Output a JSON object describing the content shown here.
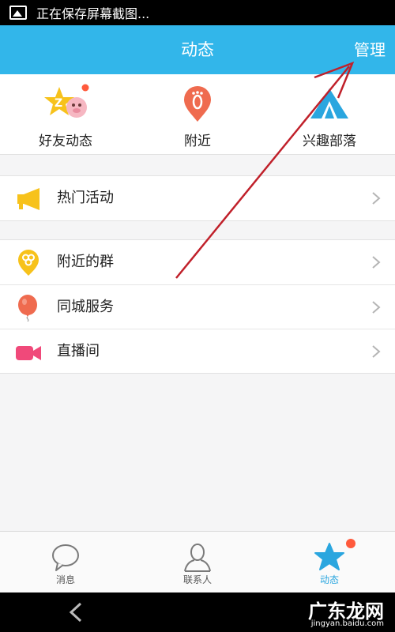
{
  "status_bar": {
    "text": "正在保存屏幕截图..."
  },
  "header": {
    "title": "动态",
    "manage_label": "管理"
  },
  "shortcuts": [
    {
      "label": "好友动态",
      "icon": "friends-feed-star-icon",
      "badge": true
    },
    {
      "label": "附近",
      "icon": "nearby-footprint-icon",
      "badge": false
    },
    {
      "label": "兴趣部落",
      "icon": "interest-tribe-tent-icon",
      "badge": false
    }
  ],
  "groups": [
    [
      {
        "label": "热门活动",
        "icon": "megaphone-icon"
      }
    ],
    [
      {
        "label": "附近的群",
        "icon": "nearby-group-icon"
      },
      {
        "label": "同城服务",
        "icon": "balloon-icon"
      },
      {
        "label": "直播间",
        "icon": "video-camera-icon"
      }
    ]
  ],
  "tabs": [
    {
      "label": "消息",
      "icon": "chat-bubble-icon",
      "active": false
    },
    {
      "label": "联系人",
      "icon": "contacts-person-icon",
      "active": false
    },
    {
      "label": "动态",
      "icon": "star-icon",
      "active": true,
      "badge": true
    }
  ],
  "watermark": {
    "text": "广东龙网",
    "url": "jingyan.baidu.com"
  },
  "colors": {
    "accent": "#32b6ea",
    "badge": "#ff5a3c",
    "annotation_arrow": "#c0202a"
  }
}
